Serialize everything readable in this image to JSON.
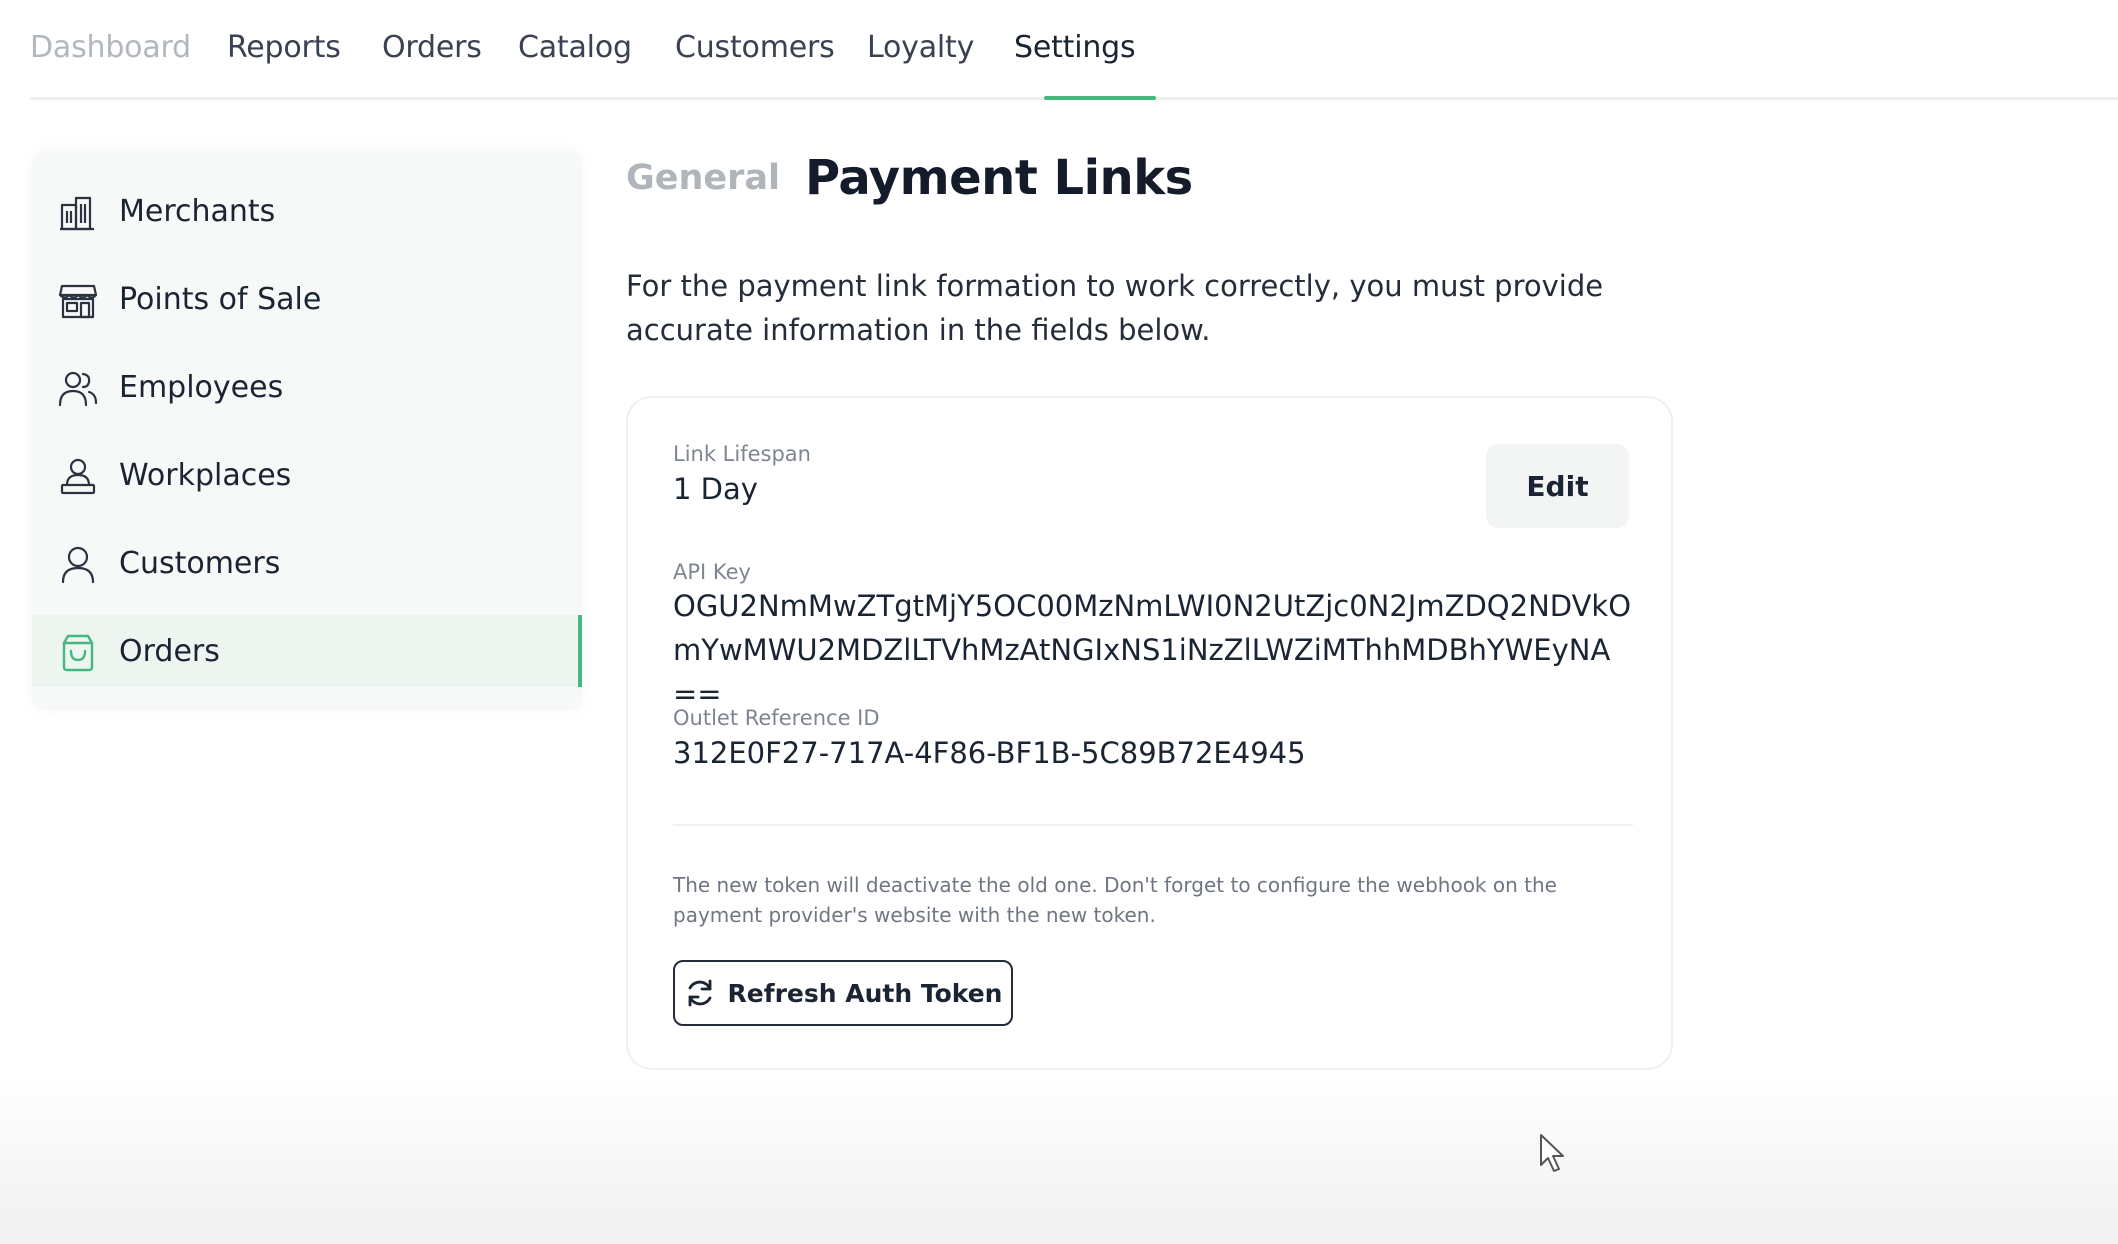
{
  "topnav": {
    "items": [
      {
        "label": "Dashboard"
      },
      {
        "label": "Reports"
      },
      {
        "label": "Orders"
      },
      {
        "label": "Catalog"
      },
      {
        "label": "Customers"
      },
      {
        "label": "Loyalty"
      },
      {
        "label": "Settings"
      }
    ],
    "active": "Settings"
  },
  "sidebar": {
    "items": [
      {
        "label": "Merchants",
        "icon": "building-icon"
      },
      {
        "label": "Points of Sale",
        "icon": "store-icon"
      },
      {
        "label": "Employees",
        "icon": "users-icon"
      },
      {
        "label": "Workplaces",
        "icon": "workplace-icon"
      },
      {
        "label": "Customers",
        "icon": "user-icon"
      },
      {
        "label": "Orders",
        "icon": "shopping-bag-icon"
      }
    ],
    "active": "Orders"
  },
  "main": {
    "subtab_general": "General",
    "title": "Payment Links",
    "description": "For the payment link formation to work correctly, you must provide accurate information in the fields below.",
    "card": {
      "link_lifespan": {
        "label": "Link Lifespan",
        "value": "1 Day"
      },
      "edit_label": "Edit",
      "api_key": {
        "label": "API Key",
        "value": "OGU2NmMwZTgtMjY5OC00MzNmLWI0N2UtZjc0N2JmZDQ2NDVkOmYwMWU2MDZlLTVhMzAtNGIxNS1iNzZlLWZiMThhMDBhYWEyNA=="
      },
      "outlet_reference": {
        "label": "Outlet Reference ID",
        "value": "312E0F27-717A-4F86-BF1B-5C89B72E4945"
      },
      "note": "The new token will deactivate the old one. Don't forget to configure the webhook on the payment provider's website with the new token.",
      "refresh_label": "Refresh Auth Token"
    }
  },
  "colors": {
    "accent": "#45b97c",
    "active_bg": "#edf5f0"
  }
}
